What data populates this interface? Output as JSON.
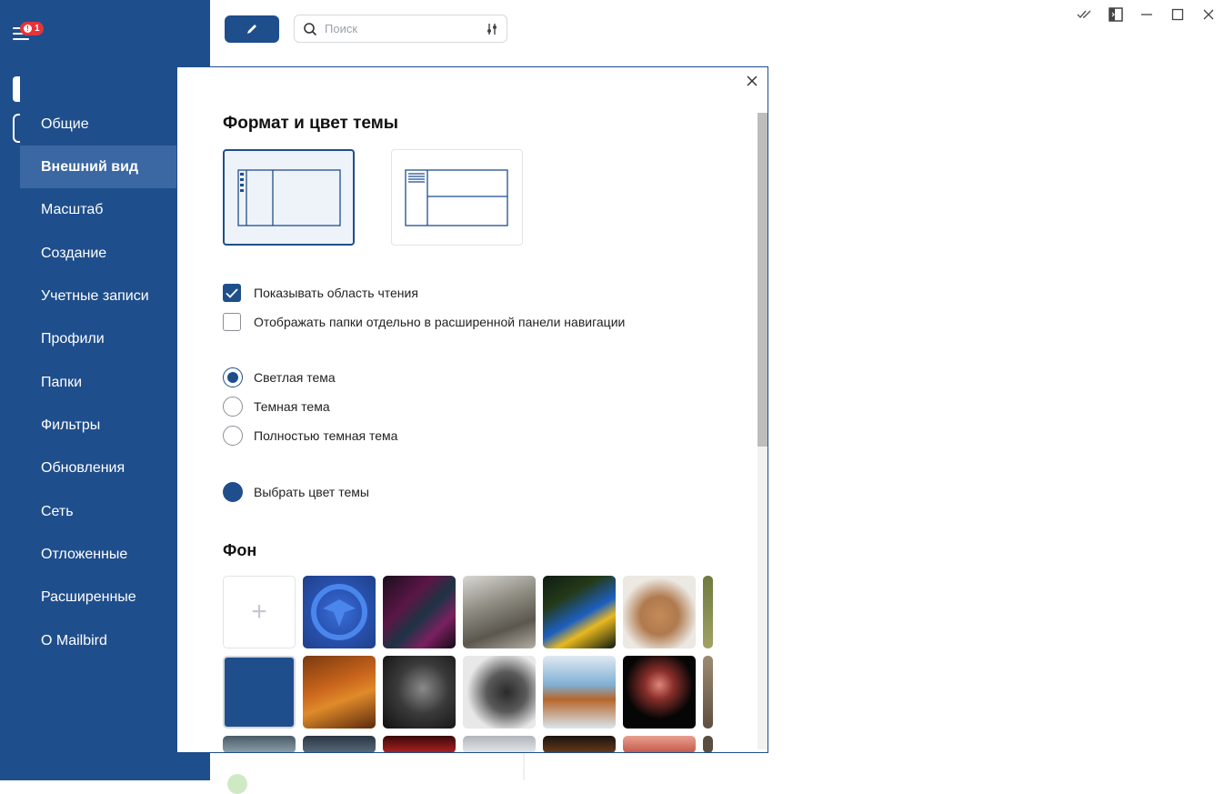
{
  "app": {
    "notification_badge": "1",
    "search_placeholder": "Поиск"
  },
  "settings_nav": {
    "items": [
      {
        "label": "Общие",
        "active": false
      },
      {
        "label": "Внешний вид",
        "active": true
      },
      {
        "label": "Масштаб",
        "active": false
      },
      {
        "label": "Создание",
        "active": false
      },
      {
        "label": "Учетные записи",
        "active": false
      },
      {
        "label": "Профили",
        "active": false
      },
      {
        "label": "Папки",
        "active": false
      },
      {
        "label": "Фильтры",
        "active": false
      },
      {
        "label": "Обновления",
        "active": false
      },
      {
        "label": "Сеть",
        "active": false
      },
      {
        "label": "Отложенные",
        "active": false
      },
      {
        "label": "Расширенные",
        "active": false
      },
      {
        "label": "О Mailbird",
        "active": false
      }
    ]
  },
  "appearance": {
    "title": "Формат и цвет темы",
    "layouts": [
      {
        "icon": "vertical-layout-icon",
        "selected": true
      },
      {
        "icon": "horizontal-layout-icon",
        "selected": false
      }
    ],
    "checkboxes": [
      {
        "label": "Показывать область чтения",
        "checked": true
      },
      {
        "label": "Отображать папки отдельно в расширенной панели навигации",
        "checked": false
      }
    ],
    "themes": [
      {
        "label": "Светлая тема",
        "selected": true
      },
      {
        "label": "Темная тема",
        "selected": false
      },
      {
        "label": "Полностью темная тема",
        "selected": false
      }
    ],
    "theme_color": {
      "label": "Выбрать цвет темы",
      "color": "#1f4e8c"
    },
    "background_title": "Фон",
    "add_background_symbol": "+"
  },
  "colors": {
    "brand": "#1f4e8c",
    "brand_active": "#3b67a3"
  }
}
